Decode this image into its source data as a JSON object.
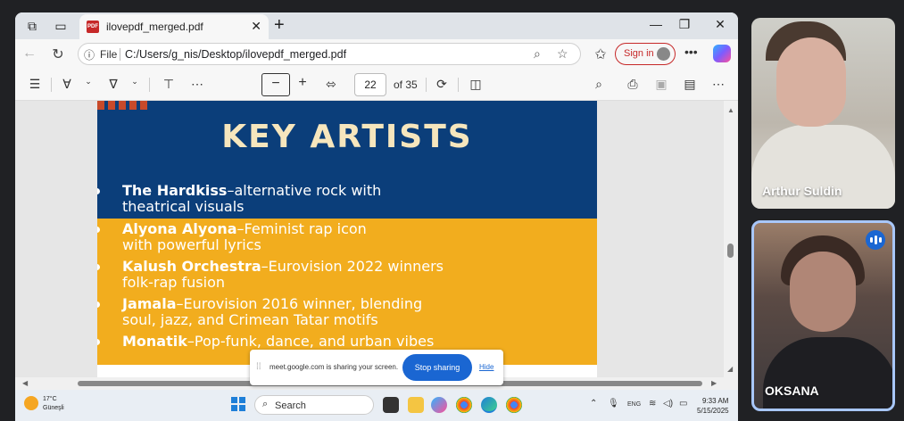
{
  "browser": {
    "tab_title": "ilovepdf_merged.pdf",
    "address": {
      "scheme_label": "File",
      "url": "C:/Users/g_nis/Desktop/ilovepdf_merged.pdf"
    },
    "signin_label": "Sign in"
  },
  "pdf_toolbar": {
    "page_current": "22",
    "page_total": "of 35",
    "zoom_out_label": "−",
    "zoom_in_label": "+"
  },
  "document": {
    "heading": "KEY ARTISTS",
    "artists": [
      {
        "name": "The Hardkiss",
        "desc_line1": "–alternative rock with",
        "desc_line2": "theatrical visuals"
      },
      {
        "name": "Alyona Alyona",
        "desc_line1": "–Feminist rap icon",
        "desc_line2": "with powerful lyrics"
      },
      {
        "name": "Kalush Orchestra",
        "desc_line1": "–Eurovision 2022 winners",
        "desc_line2": "folk-rap fusion"
      },
      {
        "name": "Jamala",
        "desc_line1": "–Eurovision 2016 winner, blending",
        "desc_line2": "soul, jazz, and Crimean Tatar motifs"
      },
      {
        "name": "Monatik",
        "desc_line1": "–Pop-funk, dance, and urban vibes",
        "desc_line2": ""
      }
    ]
  },
  "share_banner": {
    "message": "meet.google.com is sharing your screen.",
    "stop_label": "Stop sharing",
    "hide_label": "Hide"
  },
  "taskbar": {
    "weather_temp": "17°C",
    "weather_condition": "Güneşli",
    "search_label": "Search",
    "lang": "ENG",
    "time": "9:33 AM",
    "date": "5/15/2025"
  },
  "participants": [
    {
      "name": "Arthur Suldin"
    },
    {
      "name": "OKSANA",
      "speaking": true
    }
  ],
  "colors": {
    "slide_blue": "#0b3e7a",
    "slide_yellow": "#f2ad1e",
    "meet_blue": "#1a66d2",
    "signin_red": "#c62828"
  }
}
